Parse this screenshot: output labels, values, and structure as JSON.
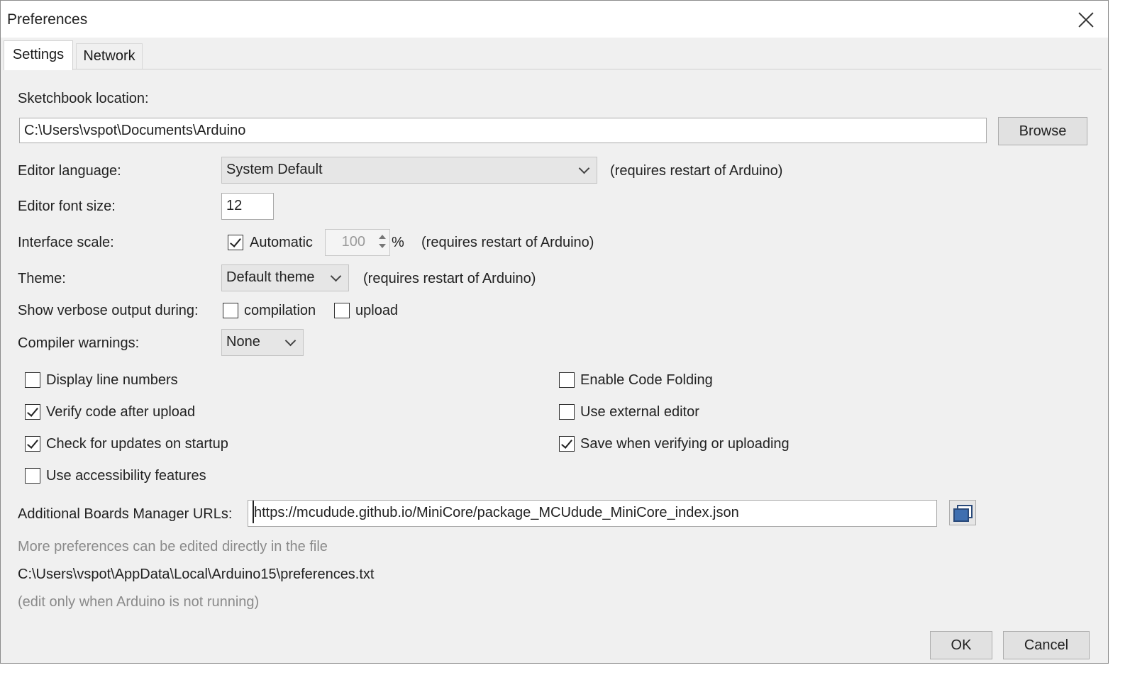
{
  "window": {
    "title": "Preferences"
  },
  "tabs": [
    {
      "label": "Settings",
      "active": true
    },
    {
      "label": "Network",
      "active": false
    }
  ],
  "sketchbook": {
    "label": "Sketchbook location:",
    "value": "C:\\Users\\vspot\\Documents\\Arduino",
    "browse_label": "Browse"
  },
  "editor_language": {
    "label": "Editor language:",
    "value": "System Default",
    "note": "(requires restart of Arduino)"
  },
  "font_size": {
    "label": "Editor font size:",
    "value": "12"
  },
  "interface_scale": {
    "label": "Interface scale:",
    "automatic_label": "Automatic",
    "automatic_checked": true,
    "value": "100",
    "unit": "%",
    "note": "(requires restart of Arduino)"
  },
  "theme": {
    "label": "Theme:",
    "value": "Default theme",
    "note": "(requires restart of Arduino)"
  },
  "verbose": {
    "label": "Show verbose output during:",
    "compilation_label": "compilation",
    "compilation_checked": false,
    "upload_label": "upload",
    "upload_checked": false
  },
  "compiler_warnings": {
    "label": "Compiler warnings:",
    "value": "None"
  },
  "options_left": [
    {
      "label": "Display line numbers",
      "checked": false
    },
    {
      "label": "Verify code after upload",
      "checked": true
    },
    {
      "label": "Check for updates on startup",
      "checked": true
    },
    {
      "label": "Use accessibility features",
      "checked": false
    }
  ],
  "options_right": [
    {
      "label": "Enable Code Folding",
      "checked": false
    },
    {
      "label": "Use external editor",
      "checked": false
    },
    {
      "label": "Save when verifying or uploading",
      "checked": true
    }
  ],
  "boards_urls": {
    "label": "Additional Boards Manager URLs:",
    "value": "https://mcudude.github.io/MiniCore/package_MCUdude_MiniCore_index.json"
  },
  "prefs_file": {
    "hint": "More preferences can be edited directly in the file",
    "path": "C:\\Users\\vspot\\AppData\\Local\\Arduino15\\preferences.txt",
    "note": "(edit only when Arduino is not running)"
  },
  "footer": {
    "ok_label": "OK",
    "cancel_label": "Cancel"
  },
  "icons": {
    "close": "close-icon",
    "dropdown": "chevron-down-icon",
    "checkbox": "checkmark-icon",
    "url_editor": "window-stack-icon",
    "spinner": "spinner-arrows-icon"
  }
}
